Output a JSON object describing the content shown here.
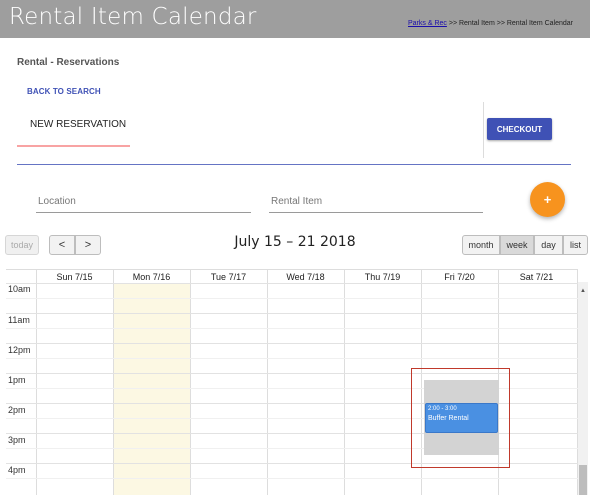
{
  "header": {
    "title": "Rental Item Calendar",
    "breadcrumb": {
      "link": "Parks & Rec",
      "sep1": " >> ",
      "item": "Rental Item",
      "sep2": " >> ",
      "current": "Rental Item Calendar"
    }
  },
  "section_title": "Rental - Reservations",
  "back_link": "BACK TO SEARCH",
  "tab_label": "NEW RESERVATION",
  "checkout_label": "CHECKOUT",
  "fields": {
    "location_placeholder": "Location",
    "rental_item_placeholder": "Rental Item"
  },
  "fab_label": "+",
  "toolbar": {
    "today": "today",
    "prev": "<",
    "next": ">",
    "title": "July 15 – 21 2018",
    "views": [
      "month",
      "week",
      "day",
      "list"
    ],
    "active_view": "week"
  },
  "days": [
    "Sun 7/15",
    "Mon 7/16",
    "Tue 7/17",
    "Wed 7/18",
    "Thu 7/19",
    "Fri 7/20",
    "Sat 7/21"
  ],
  "times": [
    "10am",
    "11am",
    "12pm",
    "1pm",
    "2pm",
    "3pm",
    "4pm"
  ],
  "event": {
    "time": "2:00 - 3:00",
    "title": "Buffer Rental",
    "day": "Fri 7/20"
  },
  "colors": {
    "header_bg": "#9e9e9e",
    "accent": "#3f51b5",
    "fab": "#f7931e",
    "today_bg": "#fcf8e3",
    "event": "#4a90e2",
    "highlight": "#c0392b"
  }
}
